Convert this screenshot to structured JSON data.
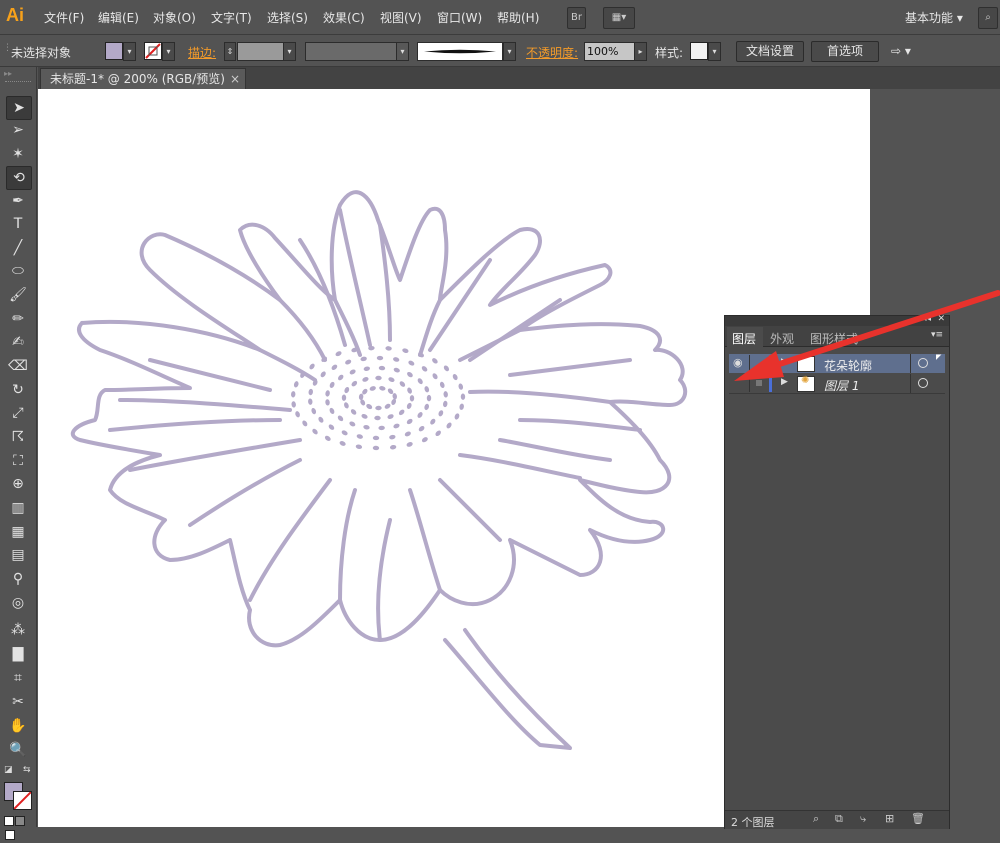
{
  "app": {
    "logo": "Ai"
  },
  "menu": [
    "文件(F)",
    "编辑(E)",
    "对象(O)",
    "文字(T)",
    "选择(S)",
    "效果(C)",
    "视图(V)",
    "窗口(W)",
    "帮助(H)"
  ],
  "menubar": {
    "bridge_label": "Br",
    "workspace": "基本功能"
  },
  "control_bar": {
    "selection_status": "未选择对象",
    "fill_color": "#b3a9c8",
    "stroke_label": "描边:",
    "opacity_label": "不透明度:",
    "opacity_value": "100%",
    "style_label": "样式:",
    "doc_setup_label": "文档设置",
    "preferences_label": "首选项"
  },
  "document_tab": {
    "title": "未标题-1* @ 200% (RGB/预览)",
    "close": "×"
  },
  "toolbox": {
    "tools": [
      "selection-tool",
      "direct-selection-tool",
      "magic-wand-tool",
      "lasso-tool",
      "pen-tool",
      "type-tool",
      "line-tool",
      "ellipse-tool",
      "paintbrush-tool",
      "pencil-tool",
      "blob-brush-tool",
      "eraser-tool",
      "rotate-tool",
      "scale-tool",
      "warp-tool",
      "free-transform-tool",
      "shape-builder-tool",
      "perspective-grid-tool",
      "mesh-tool",
      "gradient-tool",
      "eyedropper-tool",
      "blend-tool",
      "symbol-sprayer-tool",
      "column-graph-tool",
      "artboard-tool",
      "slice-tool",
      "hand-tool",
      "zoom-tool"
    ]
  },
  "artwork": {
    "stroke_color": "#b3a9c8"
  },
  "layers_panel": {
    "tabs": [
      "图层",
      "外观",
      "图形样式"
    ],
    "layers": [
      {
        "name": "花朵轮廓",
        "color": "#d04040",
        "visible": true,
        "selected": true
      },
      {
        "name": "图层 1",
        "color": "#4a6fd8",
        "visible": false,
        "selected": false
      }
    ],
    "footer_count": "2 个图层"
  },
  "annotation": {
    "arrow_color": "#e8322c"
  }
}
